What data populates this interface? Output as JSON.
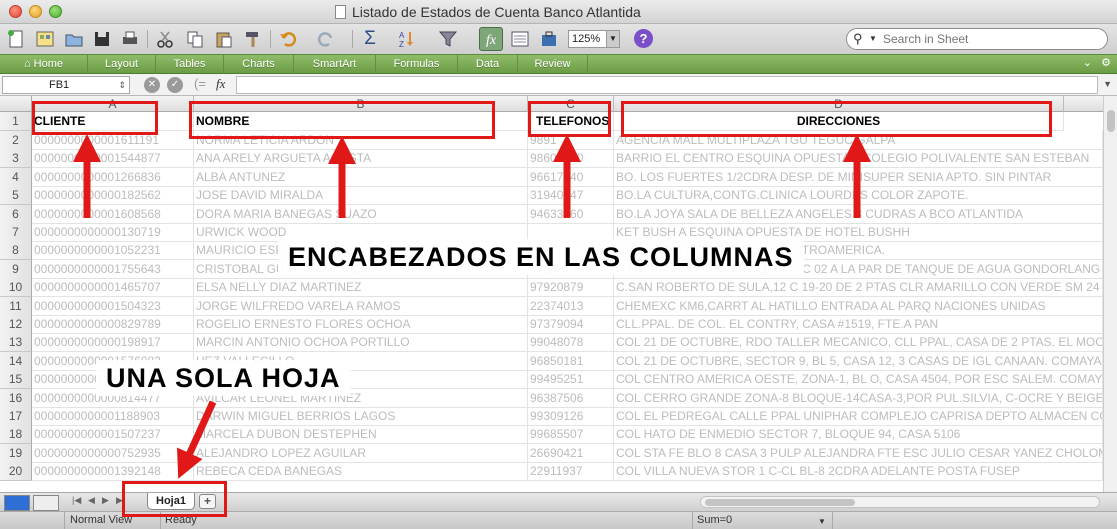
{
  "window": {
    "title": "Listado de Estados de Cuenta Banco Atlantida"
  },
  "toolbar": {
    "zoom": "125%",
    "search_placeholder": "Search in Sheet",
    "buttons": [
      "new-workbook-icon",
      "templates-icon",
      "open-icon",
      "save-icon",
      "print-icon",
      "cut-icon",
      "copy-icon",
      "paste-icon",
      "format-painter-icon",
      "undo-icon",
      "redo-icon",
      "autosum-icon",
      "sort-icon",
      "filter-icon",
      "function-icon",
      "gallery-icon",
      "toolbox-icon",
      "zoom-dropdown",
      "help-icon"
    ]
  },
  "ribbon": {
    "tabs": [
      "Home",
      "Layout",
      "Tables",
      "Charts",
      "SmartArt",
      "Formulas",
      "Data",
      "Review"
    ]
  },
  "formula_bar": {
    "name_box": "FB1",
    "fx": "fx",
    "value": ""
  },
  "grid": {
    "columns": [
      "A",
      "B",
      "C",
      "D"
    ],
    "headers": {
      "cliente": "CLIENTE",
      "nombre": "NOMBRE",
      "telefonos": "TELEFONOS",
      "direcciones": "DIRECCIONES"
    },
    "rows": [
      {
        "n": "2",
        "a": "0000000000001611191",
        "b": "NORMA LETICIA ARDON",
        "c": "9891",
        "d": "AGENCIA MALL MULTIPLAZA TGU TEGUCIGALPA"
      },
      {
        "n": "3",
        "a": "0000000000001544877",
        "b": "ANA ARELY ARGUETA ACOSTA",
        "c": "98608460",
        "d": "BARRIO EL CENTRO ESQUINA OPUESTA A COLEGIO POLIVALENTE SAN ESTEBAN"
      },
      {
        "n": "4",
        "a": "0000000000001266836",
        "b": "ALBA ANTUNEZ",
        "c": "96617840",
        "d": "BO. LOS FUERTES 1/2CDRA DESP. DE MINISUPER   SENIA APTO. SIN PINTAR"
      },
      {
        "n": "5",
        "a": "0000000000000182562",
        "b": "JOSE DAVID MIRALDA",
        "c": "31940447",
        "d": "BO.LA CULTURA,CONTG.CLINICA LOURDES COLOR ZAPOTE."
      },
      {
        "n": "6",
        "a": "0000000000001608568",
        "b": "DORA MARIA BANEGAS SUAZO",
        "c": "94633060",
        "d": "BO.LA JOYA SALA DE BELLEZA ANGELES 3 CUDRAS A BCO ATLANTIDA"
      },
      {
        "n": "7",
        "a": "0000000000000130719",
        "b": "URWICK WOOD",
        "c": "",
        "d": "KET BUSH A ESQUINA OPUESTA DE HOTEL BUSHH"
      },
      {
        "n": "8",
        "a": "0000000000001052231",
        "b": "MAURICIO ESP",
        "c": "",
        "d": "C. EDIFICIO  COPEMH BLVD CENTROAMERICA."
      },
      {
        "n": "9",
        "a": "0000000000001755643",
        "b": "CRISTOBAL GUARDADO MEJIA",
        "c": "97206105",
        "d": "C LUISIANA AV 1 B 28A CLL N 30 C 02 A LA PAR DE TANQUE DE AGUA GONDORLANG"
      },
      {
        "n": "10",
        "a": "0000000000001465707",
        "b": "ELSA NELLY DIAZ MARTINEZ",
        "c": "97920879",
        "d": "C.SAN ROBERTO DE SULA,12 C 19-20 DE 2 PTAS CLR AMARILLO CON VERDE SM 24 B 24"
      },
      {
        "n": "11",
        "a": "0000000000001504323",
        "b": "JORGE WILFREDO VARELA RAMOS",
        "c": "22374013",
        "d": "CHEMEXC KM6,CARRT AL HATILLO ENTRADA AL PARQ NACIONES UNIDAS"
      },
      {
        "n": "12",
        "a": "0000000000000829789",
        "b": "ROGELIO ERNESTO FLORES OCHOA",
        "c": "97379094",
        "d": "CLL.PPAL. DE COL. EL CONTRY, CASA #1519, FTE.A PAN"
      },
      {
        "n": "13",
        "a": "0000000000000198917",
        "b": "MARCIN ANTONIO OCHOA PORTILLO",
        "c": "99048078",
        "d": "COL 21 DE OCTUBRE, RDO TALLER MECANICO, CLL PPAL, CASA DE 2 PTAS. EL MOCHITO"
      },
      {
        "n": "14",
        "a": "0000000000001576082",
        "b": "UEZ VALLECILLO",
        "c": "96850181",
        "d": "COL 21 DE OCTUBRE, SECTOR 9, BL 5, CASA 12, 3 CASAS DE IGL CANAAN. COMAYAGUE"
      },
      {
        "n": "15",
        "a": "0000000000001396021",
        "b": "ESTRADA",
        "c": "99495251",
        "d": "COL CENTRO AMERICA OESTE, ZONA-1, BL O, CASA 4504, POR ESC SALEM. COMAYAGU"
      },
      {
        "n": "16",
        "a": "0000000000000814477",
        "b": "AVILCAR LEONEL MARTINEZ",
        "c": "96387506",
        "d": "COL CERRO GRANDE ZONA-8 BLOQUE-14CASA-3,POR PUL.SILVIA, C-OCRE Y BEIGE,POR"
      },
      {
        "n": "17",
        "a": "0000000000001188903",
        "b": "DARWIN MIGUEL BERRIOS LAGOS",
        "c": "99309126",
        "d": "COL EL PEDREGAL CALLE PPAL UNIPHAR COMPLEJO CAPRISA DEPTO ALMACEN COMAY"
      },
      {
        "n": "18",
        "a": "0000000000001507237",
        "b": "MARCELA DUBON DESTEPHEN",
        "c": "99685507",
        "d": "COL HATO DE ENMEDIO SECTOR 7, BLOQUE 94, CASA 5106"
      },
      {
        "n": "19",
        "a": "0000000000000752935",
        "b": "ALEJANDRO LOPEZ AGUILAR",
        "c": "26690421",
        "d": "COL STA FE BLO 8 CASA 3 PULP ALEJANDRA FTE ESC JULIO CESAR YANEZ CHOLOMA"
      },
      {
        "n": "20",
        "a": "0000000000001392148",
        "b": "REBECA CEDA BANEGAS",
        "c": "22911937",
        "d": "COL VILLA NUEVA STOR 1 C-CL BL-8 2CDRA ADELANTE POSTA FUSEP"
      }
    ]
  },
  "sheets": {
    "active": "Hoja1",
    "add_label": "+"
  },
  "status": {
    "view": "Normal View",
    "ready": "Ready",
    "sum": "Sum=0"
  },
  "annotations": {
    "headers_banner": "ENCABEZADOS EN LAS COLUMNAS",
    "sheet_banner": "UNA SOLA HOJA"
  },
  "colors": {
    "annotation_red": "#e01818",
    "ribbon_green": "#7bab55"
  }
}
